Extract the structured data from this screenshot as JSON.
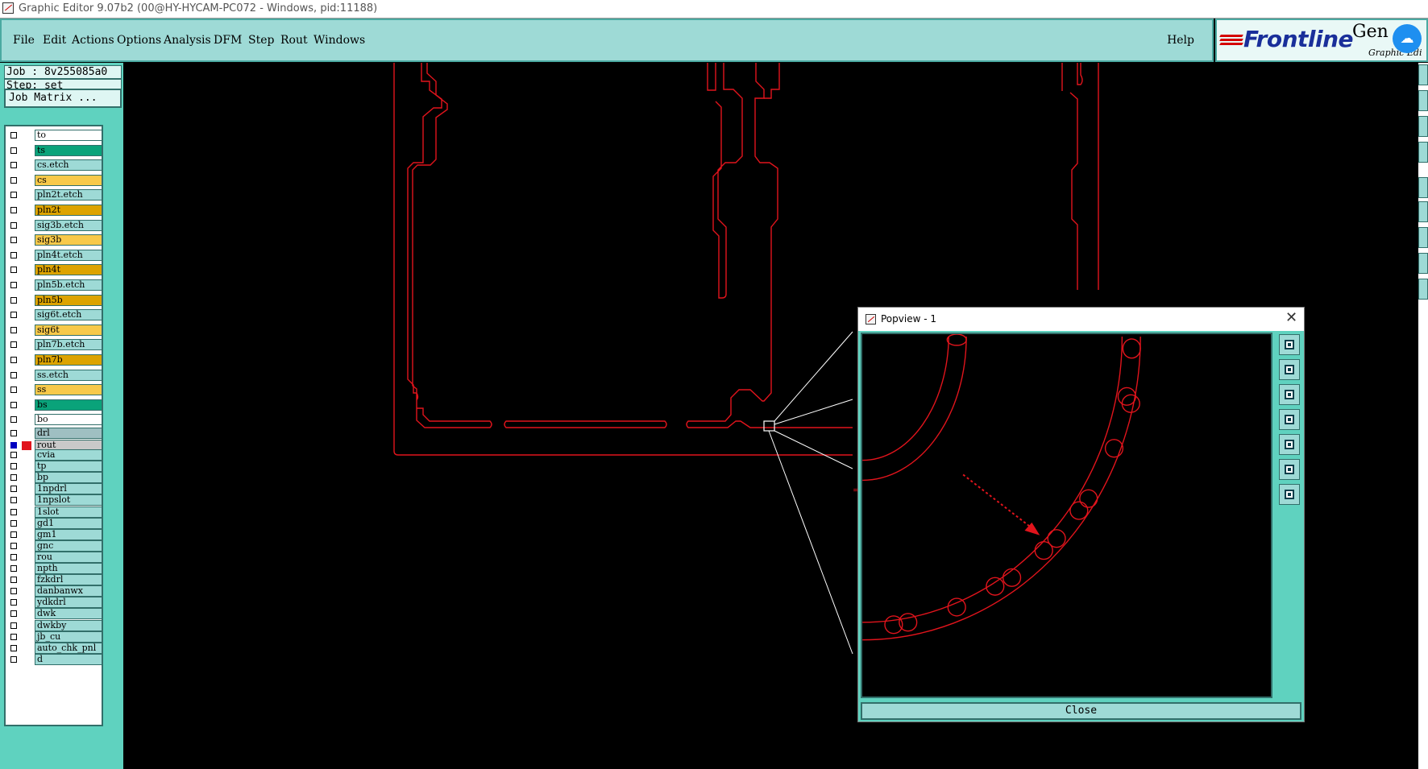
{
  "window": {
    "title": "Graphic Editor 9.07b2 (00@HY-HYCAM-PC072 - Windows, pid:11188)"
  },
  "menubar": {
    "items": [
      "File",
      "Edit",
      "Actions",
      "Options",
      "Analysis",
      "DFM",
      "Step",
      "Rout",
      "Windows"
    ],
    "help": "Help"
  },
  "logo": {
    "brand": "Frontline",
    "product": "Gen",
    "subtitle": "Graphic Edi",
    "cloud_icon": "cloud-icon"
  },
  "job_panel": {
    "job_line": "Job : 8v255085a0",
    "step_line": "Step: set",
    "matrix_button": "Job Matrix ...",
    "layers": [
      {
        "name": "to",
        "color": "#ffffff"
      },
      {
        "name": "ts",
        "color": "#0aa37a"
      },
      {
        "name": "cs.etch",
        "color": "#9edad6"
      },
      {
        "name": "cs",
        "color": "#f8c94a"
      },
      {
        "name": "pln2t.etch",
        "color": "#9edad6"
      },
      {
        "name": "pln2t",
        "color": "#dda300"
      },
      {
        "name": "sig3b.etch",
        "color": "#9edad6"
      },
      {
        "name": "sig3b",
        "color": "#f8c94a"
      },
      {
        "name": "pln4t.etch",
        "color": "#9edad6"
      },
      {
        "name": "pln4t",
        "color": "#dda300"
      },
      {
        "name": "pln5b.etch",
        "color": "#9edad6"
      },
      {
        "name": "pln5b",
        "color": "#dda300"
      },
      {
        "name": "sig6t.etch",
        "color": "#9edad6"
      },
      {
        "name": "sig6t",
        "color": "#f8c94a"
      },
      {
        "name": "pln7b.etch",
        "color": "#9edad6"
      },
      {
        "name": "pln7b",
        "color": "#dda300"
      },
      {
        "name": "ss.etch",
        "color": "#9edad6"
      },
      {
        "name": "ss",
        "color": "#f8c94a"
      },
      {
        "name": "bs",
        "color": "#0aa37a"
      },
      {
        "name": "bo",
        "color": "#ffffff"
      },
      {
        "name": "drl",
        "color": "#9fbfc2"
      },
      {
        "name": "rout",
        "color": "#c9c9c9",
        "active": true
      },
      {
        "name": "cvia",
        "color": "#9edad6"
      },
      {
        "name": "tp",
        "color": "#9edad6"
      },
      {
        "name": "bp",
        "color": "#9edad6"
      },
      {
        "name": "1npdrl",
        "color": "#9edad6"
      },
      {
        "name": "1npslot",
        "color": "#9edad6"
      },
      {
        "name": "1slot",
        "color": "#9edad6"
      },
      {
        "name": "gd1",
        "color": "#9edad6"
      },
      {
        "name": "gm1",
        "color": "#9edad6"
      },
      {
        "name": "gnc",
        "color": "#9edad6"
      },
      {
        "name": "rou",
        "color": "#9edad6"
      },
      {
        "name": "npth",
        "color": "#9edad6"
      },
      {
        "name": "fzkdrl",
        "color": "#9edad6"
      },
      {
        "name": "danbanwx",
        "color": "#9edad6"
      },
      {
        "name": "ydkdrl",
        "color": "#9edad6"
      },
      {
        "name": "dwk",
        "color": "#9edad6"
      },
      {
        "name": "dwkby",
        "color": "#9edad6"
      },
      {
        "name": "jb_cu",
        "color": "#9edad6"
      },
      {
        "name": "auto_chk_pnl",
        "color": "#9edad6"
      },
      {
        "name": "d",
        "color": "#9edad6"
      }
    ]
  },
  "popview": {
    "title": "Popview - 1",
    "close_glyph": "✕",
    "close_button": "Close",
    "tools": [
      "zoom-window-icon",
      "zoom-in-icon",
      "zoom-out-icon",
      "pan-left-icon",
      "pan-right-icon",
      "fit-icon",
      "center-icon"
    ]
  },
  "colors": {
    "rout_line": "#e1141c",
    "panel_teal": "#5fd2bf",
    "menu_bg": "#9edad6"
  }
}
